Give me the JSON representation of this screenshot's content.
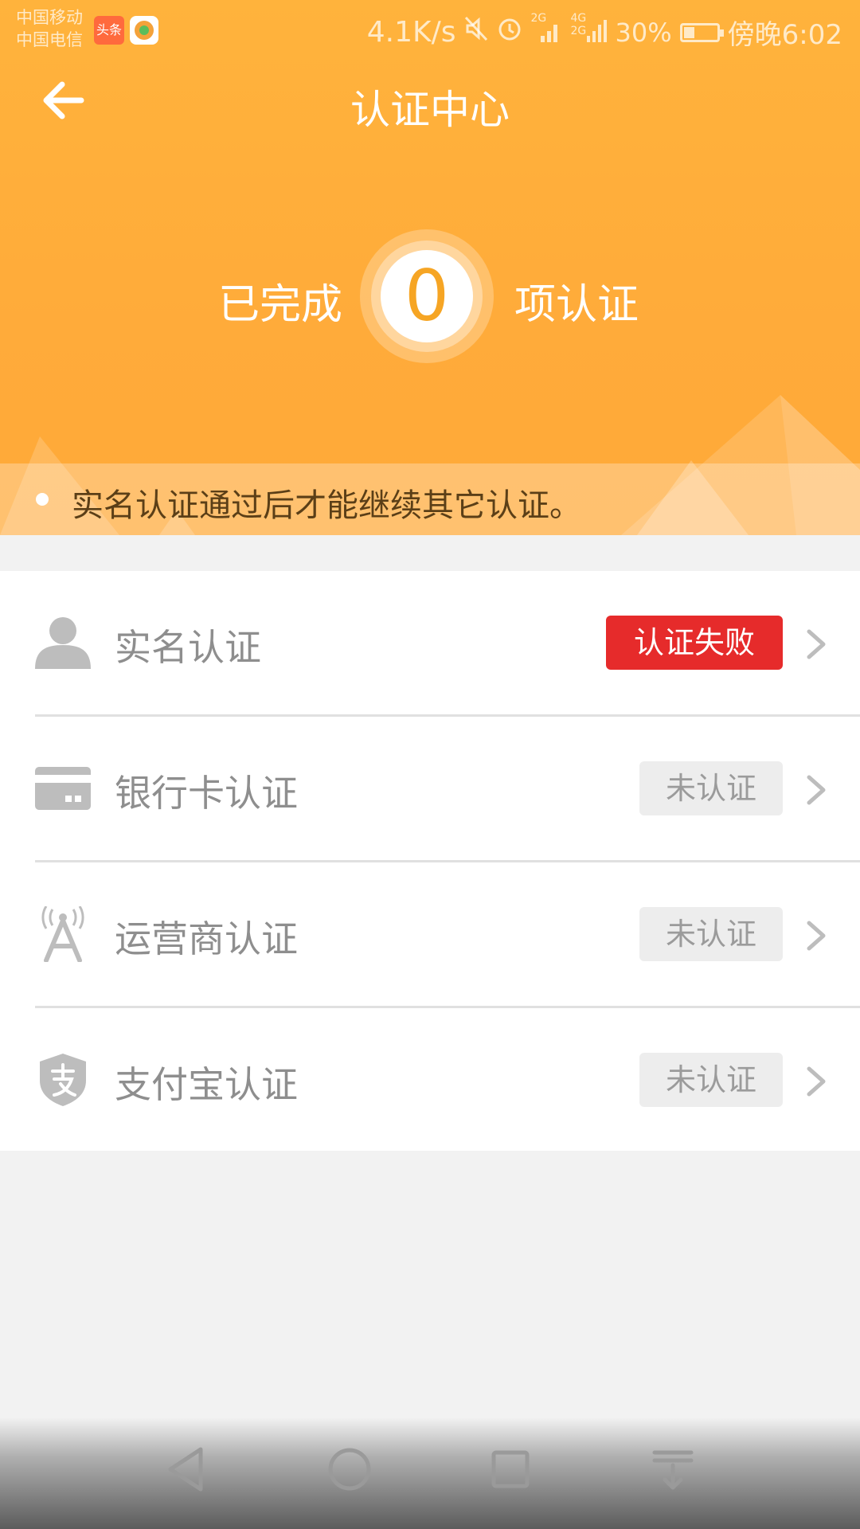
{
  "status_bar": {
    "carrier1": "中国移动",
    "carrier2": "中国电信",
    "app_badge": "头条",
    "speed": "4.1K/s",
    "network1": "2G",
    "network2": "4G",
    "network3": "2G",
    "battery": "30%",
    "time": "傍晚6:02"
  },
  "header": {
    "title": "认证中心",
    "completed_prefix": "已完成",
    "completed_count": "0",
    "completed_suffix": "项认证",
    "notice": "实名认证通过后才能继续其它认证。"
  },
  "items": [
    {
      "label": "实名认证",
      "status": "认证失败",
      "icon": "person-icon"
    },
    {
      "label": "银行卡认证",
      "status": "未认证",
      "icon": "bank-card-icon"
    },
    {
      "label": "运营商认证",
      "status": "未认证",
      "icon": "cell-tower-icon"
    },
    {
      "label": "支付宝认证",
      "status": "未认证",
      "icon": "alipay-shield-icon"
    }
  ],
  "colors": {
    "header": "#ffb03b",
    "fail": "#e62b2b",
    "count": "#f6a524"
  }
}
